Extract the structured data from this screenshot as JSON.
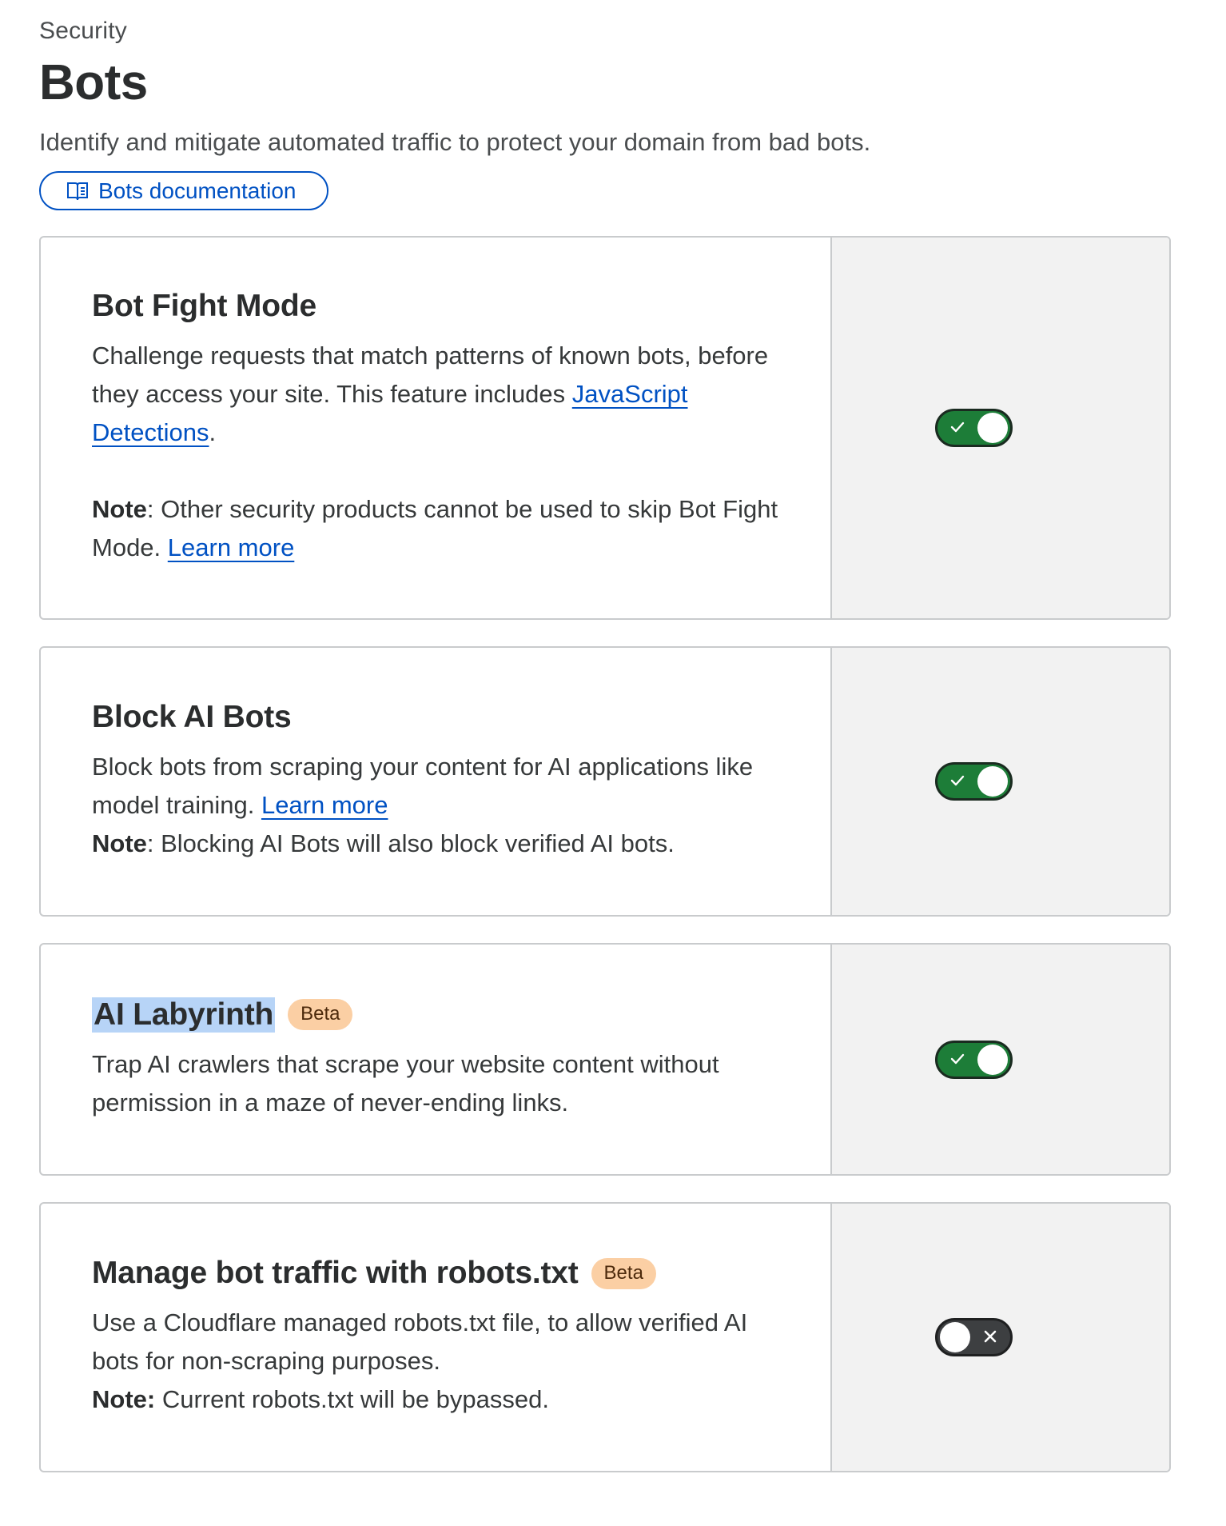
{
  "header": {
    "breadcrumb": "Security",
    "title": "Bots",
    "subtitle": "Identify and mitigate automated traffic to protect your domain from bad bots.",
    "doc_button": {
      "label": "Bots documentation",
      "icon": "book-icon"
    }
  },
  "cards": [
    {
      "title": "Bot Fight Mode",
      "badge": null,
      "text_1": "Challenge requests that match patterns of known bots, before they access your site. This feature includes ",
      "link_1": "JavaScript Detections",
      "text_1_end": ".",
      "note_label": "Note",
      "note_text": ": Other security products cannot be used to skip Bot Fight Mode. ",
      "note_link": "Learn more",
      "toggle": {
        "state": "on",
        "icon": "check-icon"
      }
    },
    {
      "title": "Block AI Bots",
      "badge": null,
      "text_1": "Block bots from scraping your content for AI applications like model training. ",
      "link_1": "Learn more",
      "note_label": "Note",
      "note_text": ": Blocking AI Bots will also block verified AI bots.",
      "toggle": {
        "state": "on",
        "icon": "check-icon"
      }
    },
    {
      "title": "AI Labyrinth",
      "badge": "Beta",
      "text_1": "Trap AI crawlers that scrape your website content without permission in a maze of never-ending links.",
      "toggle": {
        "state": "on",
        "icon": "check-icon"
      }
    },
    {
      "title": "Manage bot traffic with robots.txt",
      "badge": "Beta",
      "text_1": "Use a Cloudflare managed robots.txt file, to allow verified AI bots for non-scraping purposes.",
      "note_label": "Note:",
      "note_text": " Current robots.txt will be bypassed.",
      "toggle": {
        "state": "off",
        "icon": "close-icon"
      }
    }
  ],
  "colors": {
    "link": "#0051c3",
    "toggle_on": "#1d7d38",
    "toggle_off": "#3d3f41",
    "badge_bg": "#fbcfa4",
    "side_panel_bg": "#f2f2f2",
    "selection_highlight": "#b7d4f7"
  }
}
